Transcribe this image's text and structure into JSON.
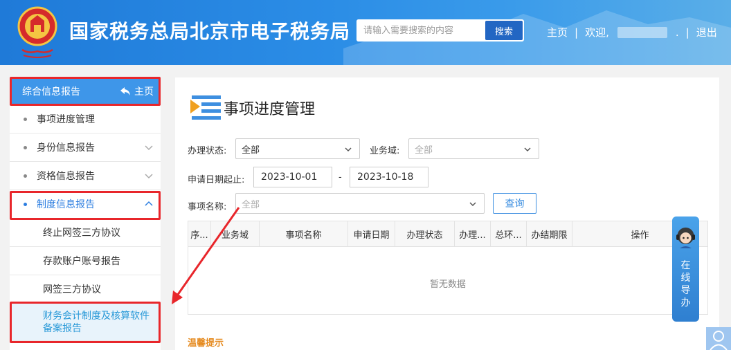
{
  "header": {
    "site_title": "国家税务总局北京市电子税务局",
    "search_placeholder": "请输入需要搜索的内容",
    "search_button": "搜索",
    "home_link": "主页",
    "welcome": "欢迎,",
    "welcome_suffix": ".",
    "logout": "退出"
  },
  "sidebar": {
    "header_title": "综合信息报告",
    "header_home": "主页",
    "items": [
      {
        "label": "事项进度管理"
      },
      {
        "label": "身份信息报告"
      },
      {
        "label": "资格信息报告"
      },
      {
        "label": "制度信息报告"
      }
    ],
    "sub_items": [
      {
        "label": "终止网签三方协议"
      },
      {
        "label": "存款账户账号报告"
      },
      {
        "label": "网签三方协议"
      },
      {
        "label": "财务会计制度及核算软件备案报告"
      }
    ]
  },
  "main": {
    "page_title": "事项进度管理",
    "form": {
      "status_label": "办理状态:",
      "status_value": "全部",
      "domain_label": "业务域:",
      "domain_placeholder": "全部",
      "date_label": "申请日期起止:",
      "date_start": "2023-10-01",
      "date_sep": "-",
      "date_end": "2023-10-18",
      "item_label": "事项名称:",
      "item_placeholder": "全部",
      "query_button": "查询"
    },
    "table": {
      "columns": [
        "序...",
        "业务域",
        "事项名称",
        "申请日期",
        "办理状态",
        "办理...",
        "总环...",
        "办结期限",
        "操作"
      ],
      "empty_text": "暂无数据"
    },
    "tip": "温馨提示"
  },
  "helper": {
    "text": "在线导办"
  },
  "colors": {
    "header_blue": "#2b8de6",
    "sidebar_head": "#3e96e9",
    "highlight_red": "#e8262b",
    "link_blue": "#2b7de0",
    "tip_orange": "#e58a1f"
  }
}
